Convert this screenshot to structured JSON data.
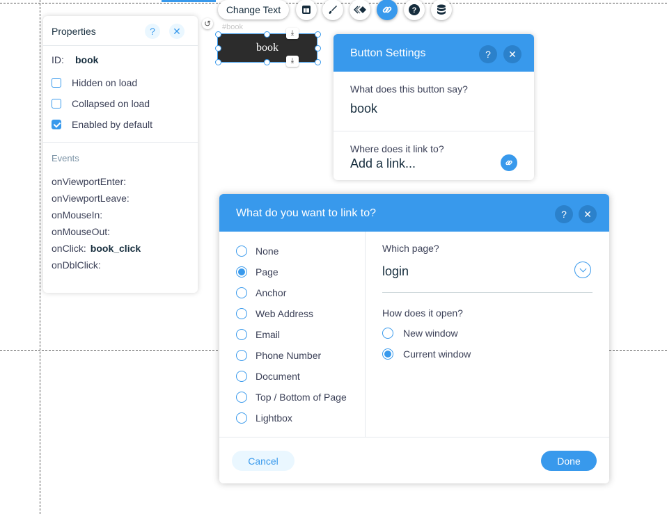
{
  "toolbar": {
    "change_text": "Change Text",
    "icons": [
      "layout-icon",
      "paint-brush-icon",
      "animation-icon",
      "link-icon",
      "help-icon",
      "database-icon"
    ],
    "active_icon": "link-icon"
  },
  "element": {
    "id_tag": "#book",
    "label": "book"
  },
  "properties": {
    "title": "Properties",
    "id_label": "ID:",
    "id_value": "book",
    "checkboxes": [
      {
        "label": "Hidden on load",
        "checked": false
      },
      {
        "label": "Collapsed on load",
        "checked": false
      },
      {
        "label": "Enabled by default",
        "checked": true
      }
    ],
    "events_title": "Events",
    "events": [
      {
        "name": "onViewportEnter:",
        "handler": ""
      },
      {
        "name": "onViewportLeave:",
        "handler": ""
      },
      {
        "name": "onMouseIn:",
        "handler": ""
      },
      {
        "name": "onMouseOut:",
        "handler": ""
      },
      {
        "name": "onClick:",
        "handler": "book_click"
      },
      {
        "name": "onDblClick:",
        "handler": ""
      }
    ]
  },
  "button_settings": {
    "title": "Button Settings",
    "say_label": "What does this button say?",
    "say_value": "book",
    "link_label": "Where does it link to?",
    "link_value": "Add a link..."
  },
  "link_dialog": {
    "title": "What do you want to link to?",
    "options": [
      "None",
      "Page",
      "Anchor",
      "Web Address",
      "Email",
      "Phone Number",
      "Document",
      "Top / Bottom of Page",
      "Lightbox"
    ],
    "selected_option": "Page",
    "which_page_label": "Which page?",
    "which_page_value": "login",
    "open_label": "How does it open?",
    "open_options": [
      "New window",
      "Current window"
    ],
    "selected_open": "Current window",
    "cancel": "Cancel",
    "done": "Done"
  },
  "colors": {
    "accent": "#3899ec",
    "accent_dark": "#2b81cb",
    "button_bg": "#2c2c2c"
  }
}
